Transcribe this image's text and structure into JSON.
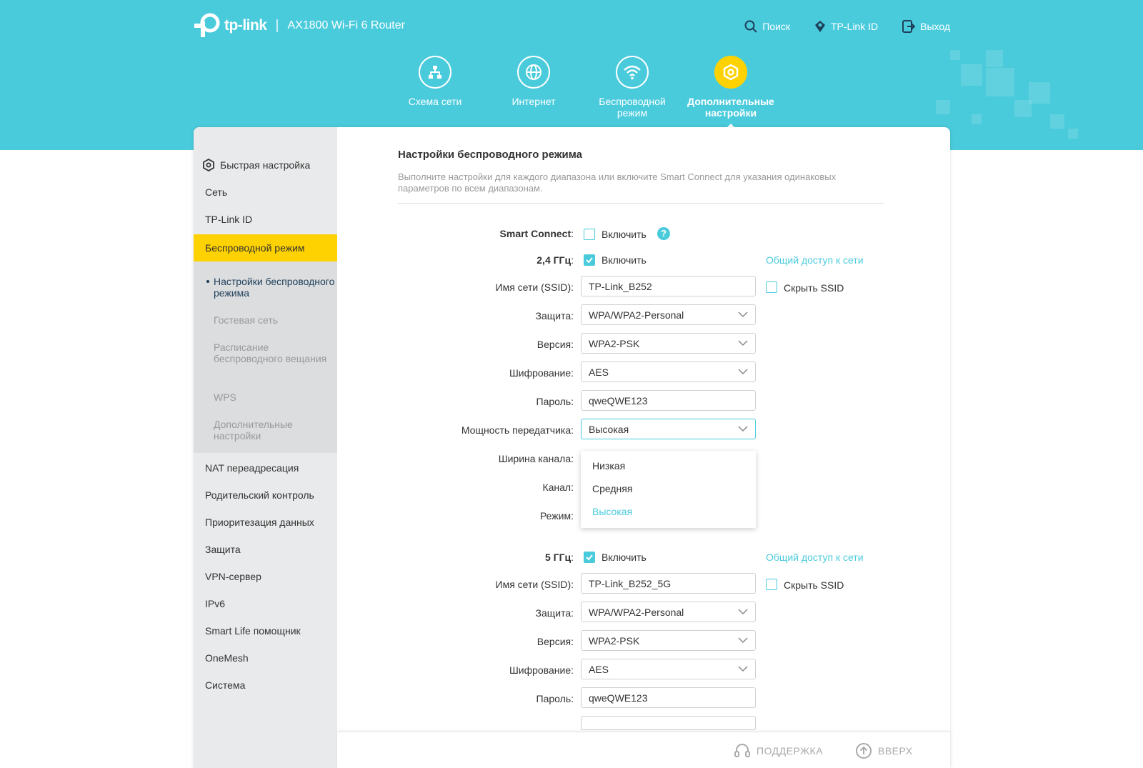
{
  "header": {
    "logo_text": "tp-link",
    "model": "AX1800 Wi-Fi 6 Router",
    "top_links": [
      {
        "label": "Поиск",
        "icon": "search-icon"
      },
      {
        "label": "TP-Link ID",
        "icon": "tplink-id-icon"
      },
      {
        "label": "Выход",
        "icon": "logout-icon"
      }
    ],
    "nav": [
      {
        "label": "Схема сети",
        "icon": "network-map-icon"
      },
      {
        "label": "Интернет",
        "icon": "globe-icon"
      },
      {
        "label": "Беспроводной режим",
        "icon": "wifi-icon"
      },
      {
        "label": "Дополнительные настройки",
        "icon": "gear-icon",
        "active": true
      }
    ]
  },
  "sidebar": {
    "quick_setup": "Быстрая настройка",
    "items": [
      "Сеть",
      "TP-Link ID",
      "Беспроводной режим"
    ],
    "active": "Беспроводной режим",
    "sub_items": [
      "Настройки беспроводного режима",
      "Гостевая сеть",
      "Расписание беспроводного вещания",
      "WPS",
      "Дополнительные настройки"
    ],
    "items_after": [
      "NAT переадресация",
      "Родительский контроль",
      "Приоритезация данных",
      "Защита",
      "VPN-сервер",
      "IPv6",
      "Smart Life помощник",
      "OneMesh",
      "Система"
    ]
  },
  "main": {
    "title": "Настройки беспроводного режима",
    "description": "Выполните настройки для каждого диапазона или включите Smart Connect для указания одинаковых параметров по всем диапазонам.",
    "smart_connect": {
      "label": "Smart Connect",
      "checkbox_label": "Включить",
      "checked": false,
      "help": "?"
    },
    "band_24": {
      "label": "2,4 ГГц",
      "enable_label": "Включить",
      "enabled": true,
      "share_link": "Общий доступ к сети",
      "ssid_label": "Имя сети (SSID):",
      "ssid": "TP-Link_B252",
      "hide_ssid_label": "Скрыть SSID",
      "security_label": "Защита:",
      "security": "WPA/WPA2-Personal",
      "version_label": "Версия:",
      "version": "WPA2-PSK",
      "encryption_label": "Шифрование:",
      "encryption": "AES",
      "password_label": "Пароль:",
      "password": "qweQWE123",
      "tx_power_label": "Мощность передатчика:",
      "tx_power": "Высокая",
      "channel_width_label": "Ширина канала:",
      "channel_label": "Канал:",
      "mode_label": "Режим:"
    },
    "tx_power_options": [
      "Низкая",
      "Средняя",
      "Высокая"
    ],
    "band_5": {
      "label": "5 ГГц",
      "enable_label": "Включить",
      "enabled": true,
      "share_link": "Общий доступ к сети",
      "ssid_label": "Имя сети (SSID):",
      "ssid": "TP-Link_B252_5G",
      "hide_ssid_label": "Скрыть SSID",
      "security_label": "Защита:",
      "security": "WPA/WPA2-Personal",
      "version_label": "Версия:",
      "version": "WPA2-PSK",
      "encryption_label": "Шифрование:",
      "encryption": "AES",
      "password_label": "Пароль:",
      "password": "qweQWE123"
    }
  },
  "footer": {
    "support": "ПОДДЕРЖКА",
    "top": "ВВЕРХ"
  },
  "colors": {
    "accent": "#4acbdc",
    "active_yellow": "#fed200",
    "sidebar_bg": "#e9eaeb"
  }
}
